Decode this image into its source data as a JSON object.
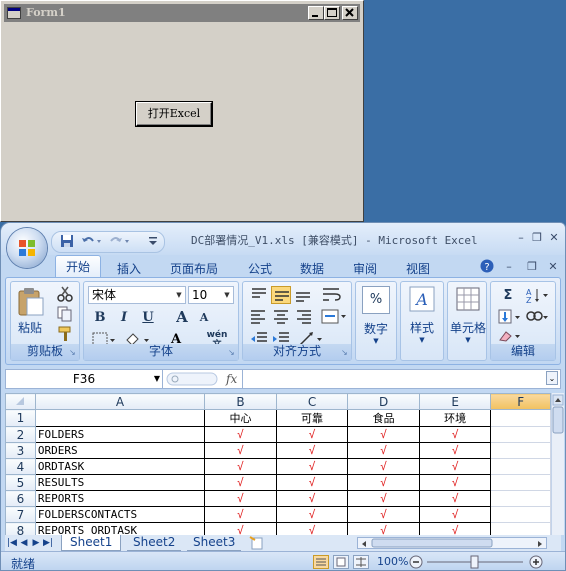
{
  "form": {
    "title": "Form1",
    "button_label": "打开Excel"
  },
  "excel": {
    "title": "DC部署情况_V1.xls  [兼容模式] - Microsoft Excel",
    "tabs": [
      "开始",
      "插入",
      "页面布局",
      "公式",
      "数据",
      "审阅",
      "视图"
    ],
    "active_tab": "开始",
    "groups": {
      "clipboard": {
        "label": "剪贴板",
        "paste": "粘贴"
      },
      "font": {
        "label": "字体",
        "font_name": "宋体",
        "font_size": "10",
        "bold": "B",
        "italic": "I",
        "underline": "U",
        "grow": "A",
        "shrink": "A",
        "font_color": "A",
        "phonetic": "wén 文"
      },
      "alignment": {
        "label": "对齐方式"
      },
      "number": {
        "label": "数字",
        "symbol": "%"
      },
      "styles": {
        "label": "样式"
      },
      "cells": {
        "label": "单元格"
      },
      "editing": {
        "label": "编辑",
        "sum": "Σ"
      }
    },
    "name_box": "F36",
    "fx_label": "fx",
    "formula": "",
    "columns": [
      "A",
      "B",
      "C",
      "D",
      "E",
      "F"
    ],
    "selected_column": "F",
    "header_row": {
      "row": "1",
      "cells": [
        "",
        "中心",
        "可靠",
        "食品",
        "环境"
      ]
    },
    "rows": [
      {
        "row": "2",
        "name": "FOLDERS",
        "marks": [
          "√",
          "√",
          "√",
          "√"
        ]
      },
      {
        "row": "3",
        "name": "ORDERS",
        "marks": [
          "√",
          "√",
          "√",
          "√"
        ]
      },
      {
        "row": "4",
        "name": "ORDTASK",
        "marks": [
          "√",
          "√",
          "√",
          "√"
        ]
      },
      {
        "row": "5",
        "name": "RESULTS",
        "marks": [
          "√",
          "√",
          "√",
          "√"
        ]
      },
      {
        "row": "6",
        "name": "REPORTS",
        "marks": [
          "√",
          "√",
          "√",
          "√"
        ]
      },
      {
        "row": "7",
        "name": "FOLDERSCONTACTS",
        "marks": [
          "√",
          "√",
          "√",
          "√"
        ]
      },
      {
        "row": "8",
        "name": "REPORTS_ORDTASK",
        "marks": [
          "√",
          "√",
          "√",
          "√"
        ]
      }
    ],
    "sheets": [
      "Sheet1",
      "Sheet2",
      "Sheet3"
    ],
    "status": "就绪",
    "zoom": "100%",
    "check_color": "#e02020"
  }
}
